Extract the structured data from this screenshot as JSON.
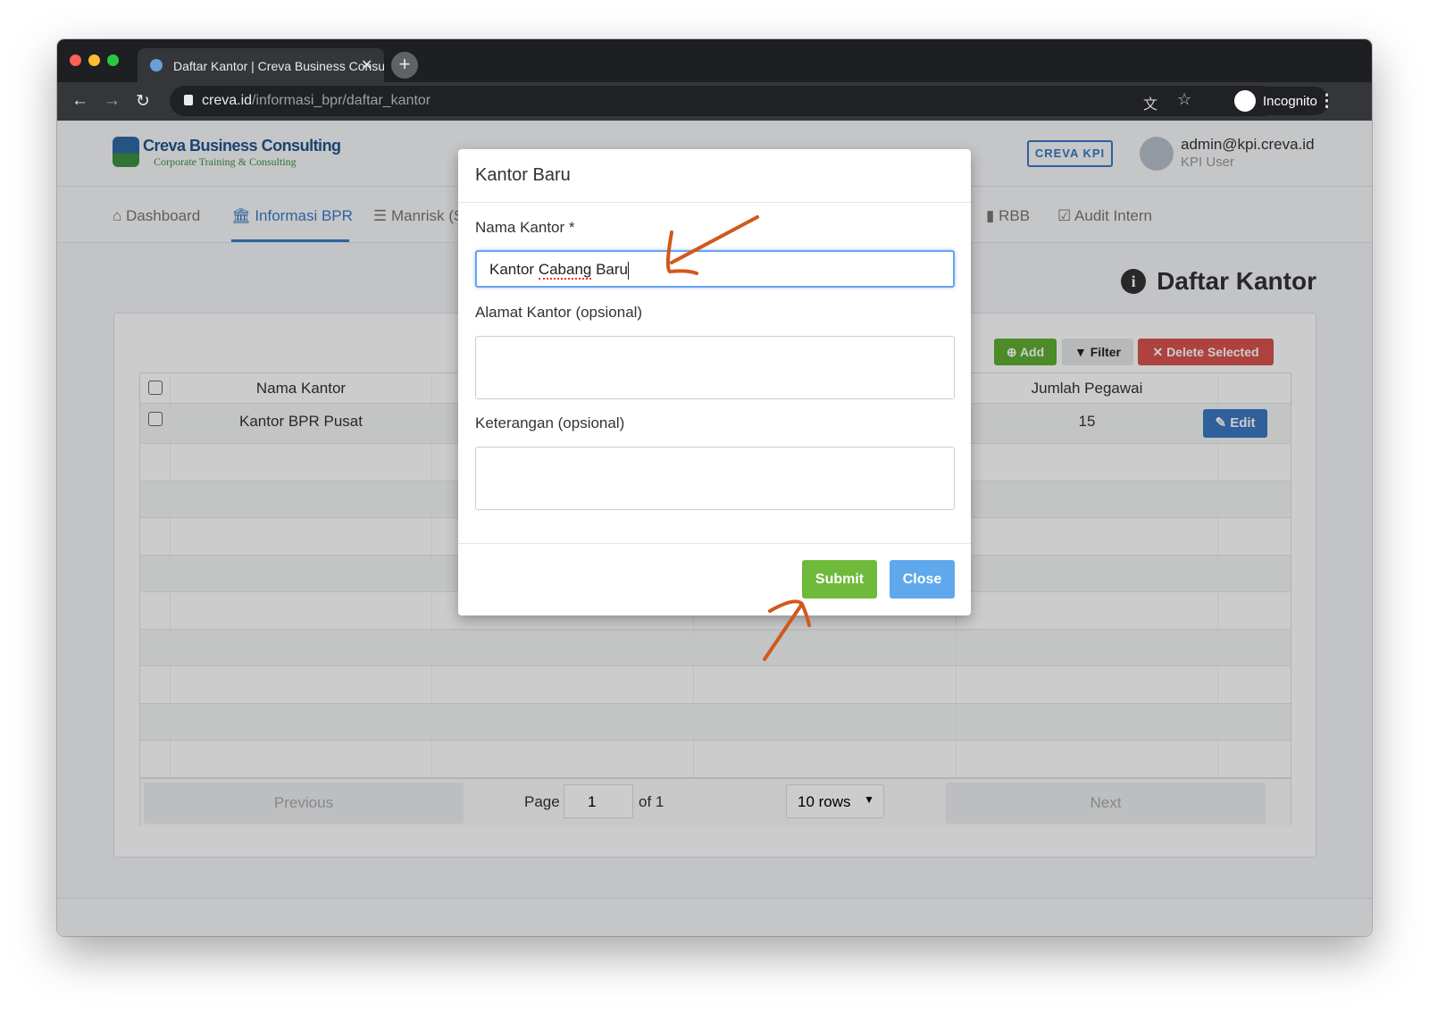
{
  "browser": {
    "tab_title": "Daftar Kantor | Creva Business Consulting",
    "url_host": "creva.id",
    "url_path": "/informasi_bpr/daftar_kantor",
    "profile": "Incognito"
  },
  "header": {
    "brand": "Creva Business Consulting",
    "tagline": "Corporate Training & Consulting",
    "kpi_button": "CREVA KPI",
    "user_email": "admin@kpi.creva.id",
    "user_role": "KPI User"
  },
  "nav": {
    "items": [
      {
        "label": "Dashboard",
        "icon": "home-icon"
      },
      {
        "label": "Informasi BPR",
        "icon": "bank-icon",
        "active": true
      },
      {
        "label": "Manrisk (S",
        "icon": "list-icon"
      },
      {
        "label": "RBB",
        "icon": "book-icon"
      },
      {
        "label": "Audit Intern",
        "icon": "clipboard-check-icon"
      }
    ]
  },
  "main": {
    "title": "Daftar Kantor",
    "toolbar": {
      "add": "Add",
      "filter": "Filter",
      "delete": "Delete Selected"
    },
    "table": {
      "columns": [
        "Nama Kantor",
        "",
        "",
        "Jumlah Pegawai",
        ""
      ],
      "rows": [
        {
          "nama": "Kantor BPR Pusat",
          "jumlah": "15",
          "action": "Edit"
        }
      ]
    },
    "pagination": {
      "previous": "Previous",
      "page_label": "Page",
      "page": "1",
      "of": "of 1",
      "rows": "10 rows",
      "next": "Next"
    }
  },
  "modal": {
    "title": "Kantor Baru",
    "fields": [
      {
        "label": "Nama Kantor *",
        "value_a": "Kantor ",
        "value_b": "Cabang",
        "value_c": " Baru"
      },
      {
        "label": "Alamat Kantor (opsional)",
        "value": ""
      },
      {
        "label": "Keterangan (opsional)",
        "value": ""
      }
    ],
    "submit": "Submit",
    "close": "Close"
  },
  "colors": {
    "accent": "#3a7bc8",
    "add": "#5fae32",
    "delete": "#d9534f",
    "submit": "#6fba3a",
    "close": "#5fa8ec",
    "annotation": "#d2581c"
  }
}
